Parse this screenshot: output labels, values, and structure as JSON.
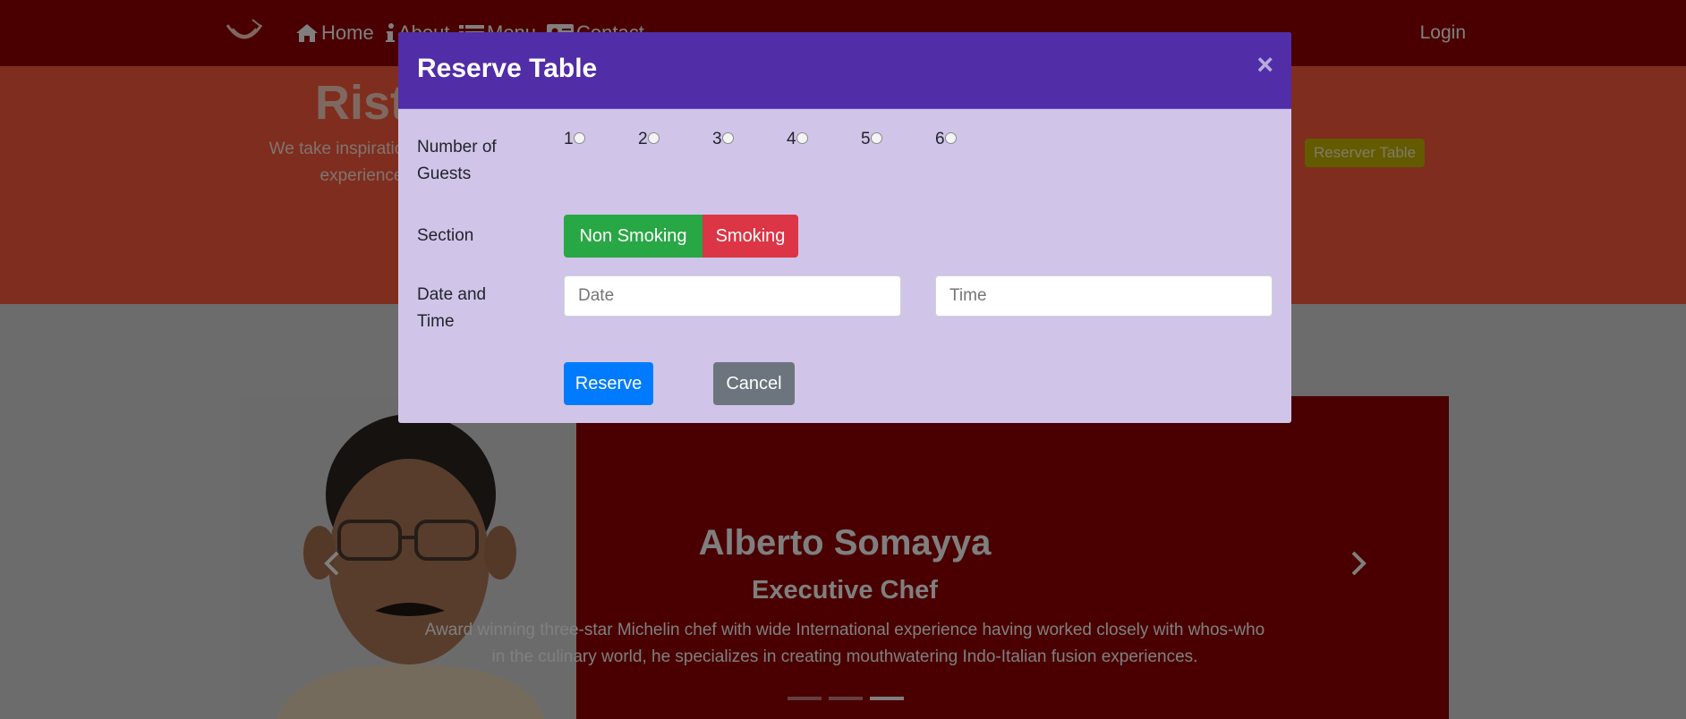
{
  "nav": {
    "items": [
      {
        "label": "Home",
        "icon": "home-icon"
      },
      {
        "label": "About",
        "icon": "info-icon"
      },
      {
        "label": "Menu",
        "icon": "list-icon"
      },
      {
        "label": "Contact",
        "icon": "address-card-icon"
      }
    ],
    "login": "Login"
  },
  "jumbotron": {
    "title": "Riste",
    "description": "We take inspiratio fusion experience",
    "reserve_button": "Reserver Table"
  },
  "carousel": {
    "name": "Alberto Somayya",
    "role": "Executive Chef",
    "bio": "Award winning three-star Michelin chef with wide International experience having worked closely with whos-who in the culinary world, he specializes in creating mouthwatering Indo-Italian fusion experiences.",
    "active_slide": 3,
    "slide_count": 3
  },
  "modal": {
    "title": "Reserve Table",
    "close": "×",
    "guests_label": "Number of Guests",
    "guest_options": [
      "1",
      "2",
      "3",
      "4",
      "5",
      "6"
    ],
    "section_label": "Section",
    "section_options": [
      "Non Smoking",
      "Smoking"
    ],
    "datetime_label": "Date and Time",
    "date_placeholder": "Date",
    "time_placeholder": "Time",
    "reserve_button": "Reserve",
    "cancel_button": "Cancel"
  },
  "colors": {
    "navbar": "#940000",
    "jumbotron": "#ff5a3c",
    "modal_header": "#512da8",
    "modal_body": "#d1c4e9",
    "success": "#28a745",
    "danger": "#dc3545",
    "primary": "#007bff",
    "secondary": "#6c757d"
  }
}
